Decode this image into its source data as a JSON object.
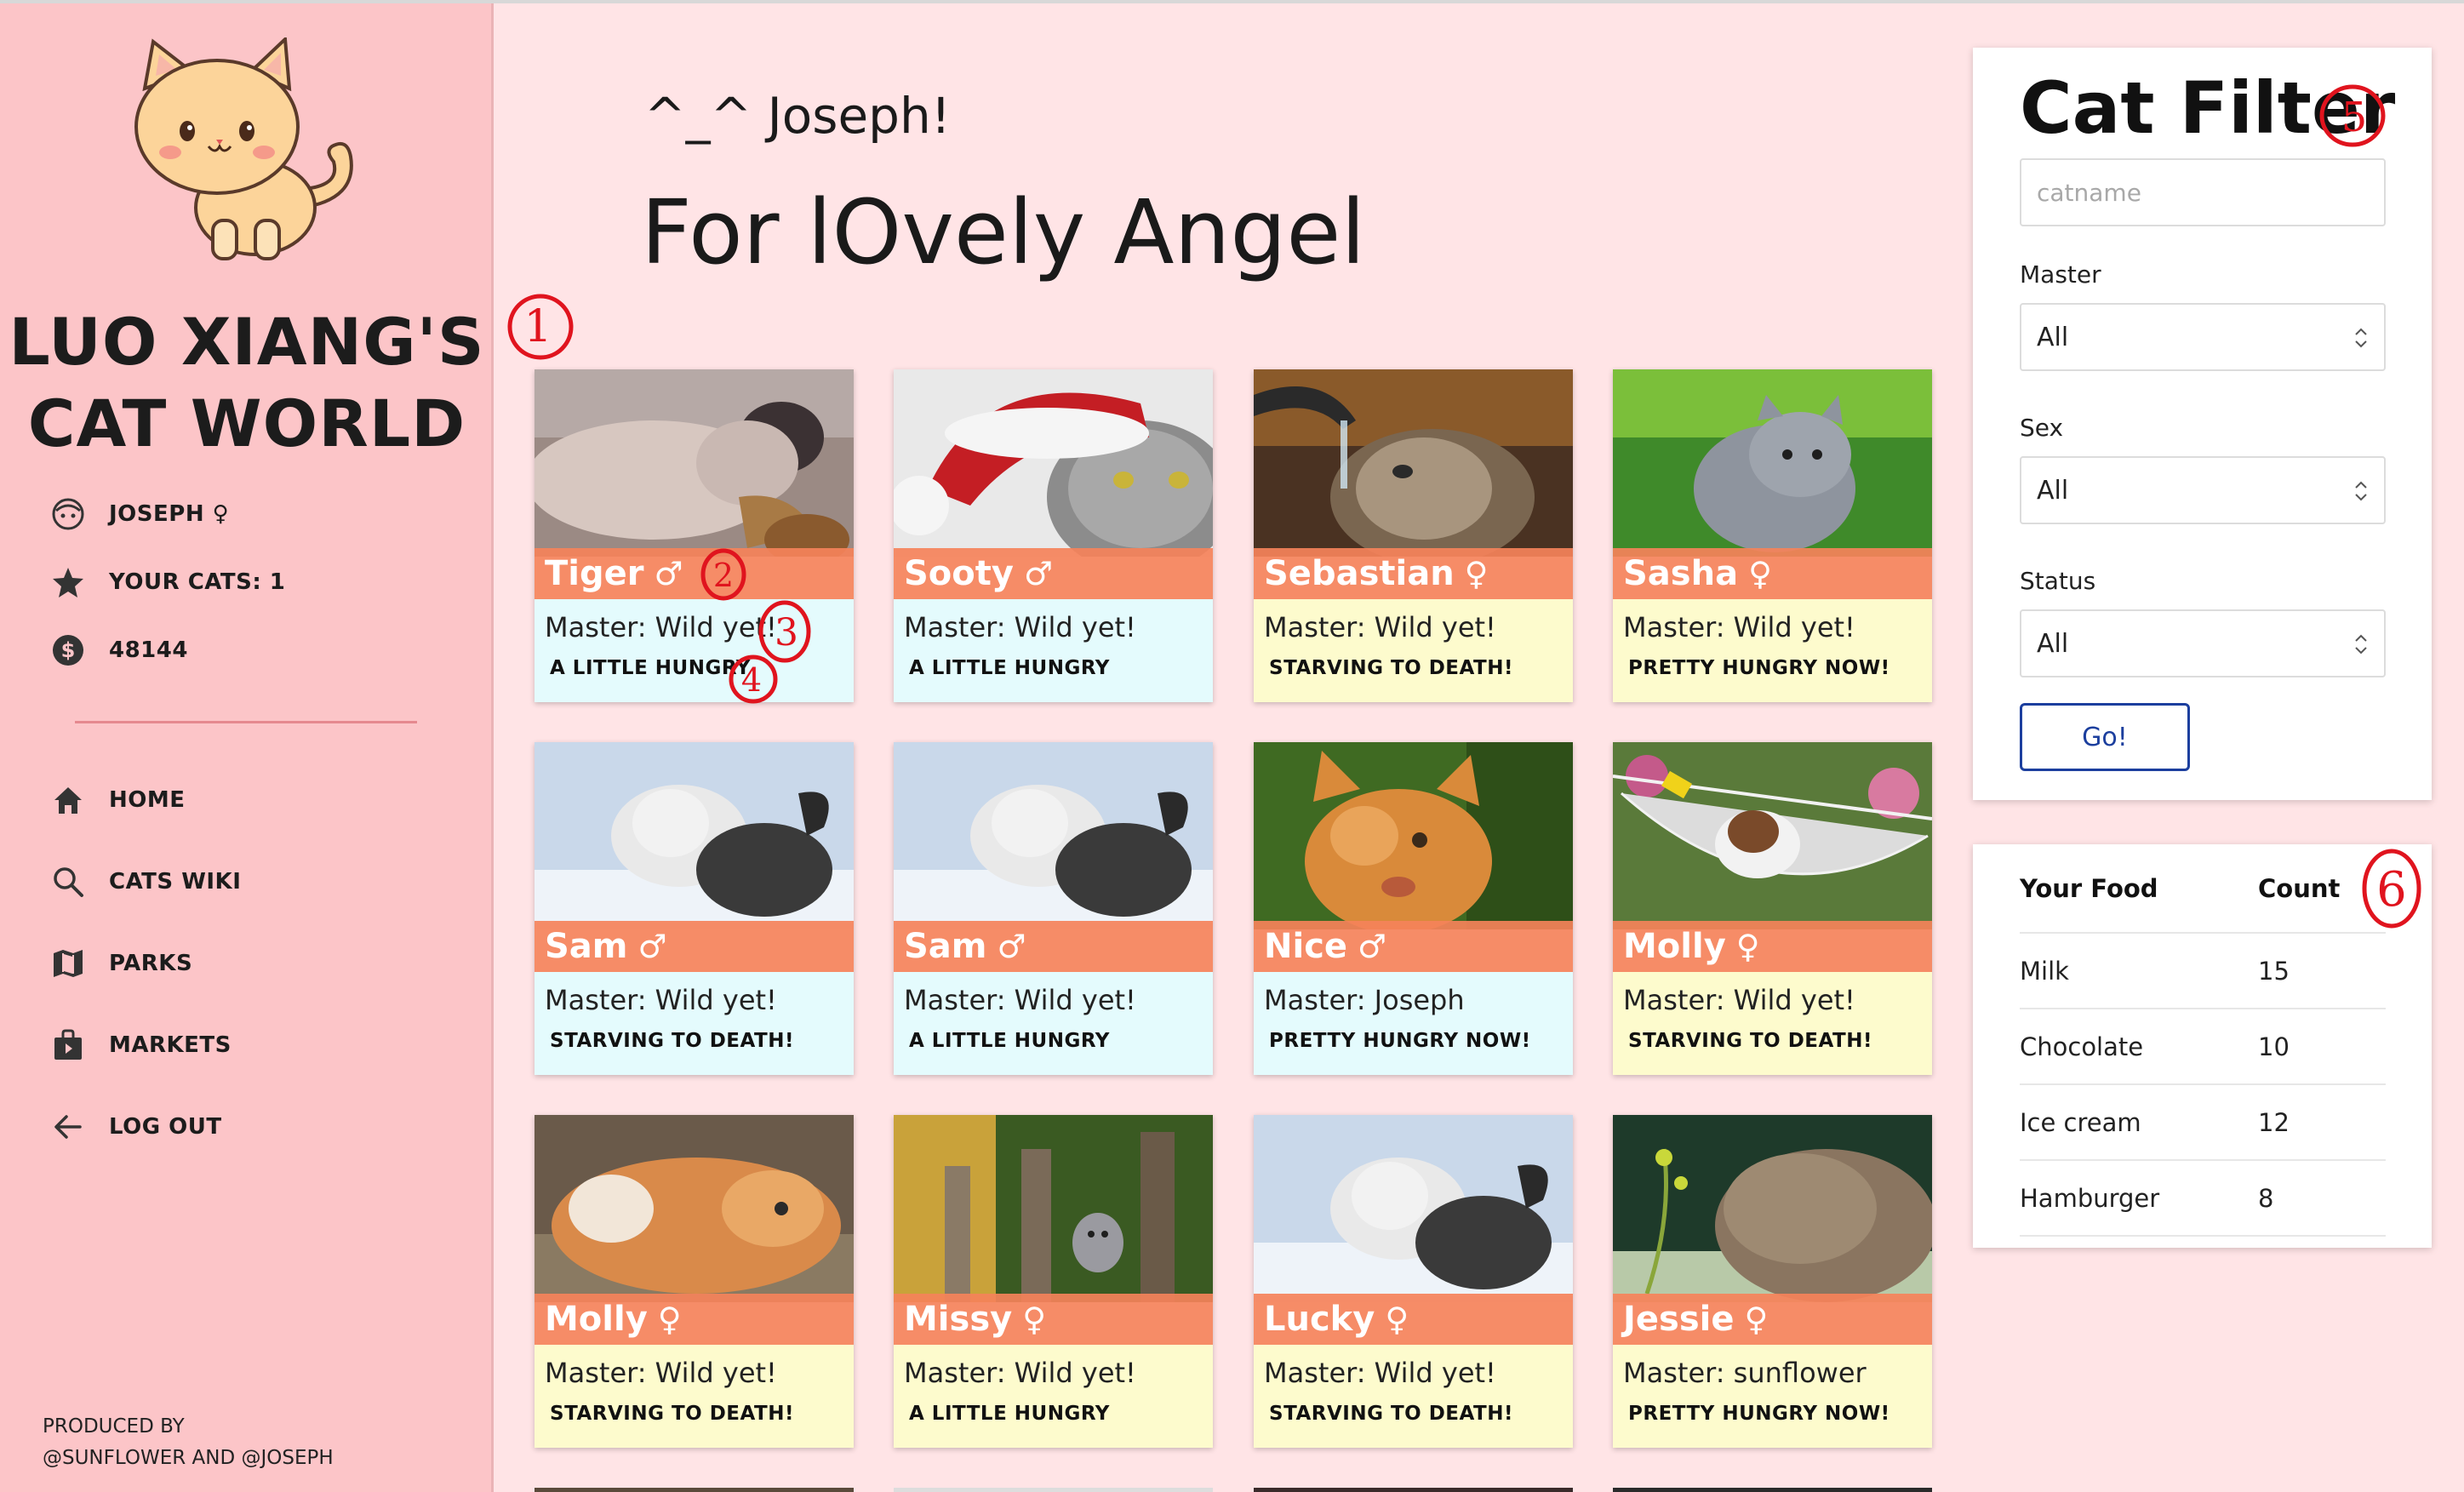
{
  "sidebar": {
    "brand_line1": "LUO XIANG'S",
    "brand_line2": "CAT WORLD",
    "user": {
      "name": "JOSEPH ♀",
      "cats": "YOUR CATS: 1",
      "money": "48144"
    },
    "nav": [
      {
        "label": "HOME",
        "icon": "home-icon"
      },
      {
        "label": "CATS WIKI",
        "icon": "search-icon"
      },
      {
        "label": "PARKS",
        "icon": "map-icon"
      },
      {
        "label": "MARKETS",
        "icon": "shopping-bag-icon"
      },
      {
        "label": "LOG OUT",
        "icon": "arrow-left-icon"
      }
    ],
    "credits_line1": "PRODUCED BY",
    "credits_line2": "@SUNFLOWER AND @JOSEPH"
  },
  "main": {
    "greeting": "^_^ Joseph!",
    "title": "For lOvely Angel",
    "cards": [
      {
        "name": "Tiger",
        "sex": "♂",
        "master": "Master: Wild yet!",
        "status": "A LITTLE HUNGRY",
        "tint": "mint",
        "photo": "sleeping-kitten-photo"
      },
      {
        "name": "Sooty",
        "sex": "♂",
        "master": "Master: Wild yet!",
        "status": "A LITTLE HUNGRY",
        "tint": "mint",
        "photo": "santa-hat-cat-photo"
      },
      {
        "name": "Sebastian",
        "sex": "♀",
        "master": "Master: Wild yet!",
        "status": "STARVING TO DEATH!",
        "tint": "cream",
        "photo": "cat-drinking-tap-photo"
      },
      {
        "name": "Sasha",
        "sex": "♀",
        "master": "Master: Wild yet!",
        "status": "PRETTY HUNGRY NOW!",
        "tint": "cream",
        "photo": "grey-kitten-grass-photo"
      },
      {
        "name": "Sam",
        "sex": "♂",
        "master": "Master: Wild yet!",
        "status": "STARVING TO DEATH!",
        "tint": "mint",
        "photo": "cat-in-snow-photo"
      },
      {
        "name": "Sam",
        "sex": "♂",
        "master": "Master: Wild yet!",
        "status": "A LITTLE HUNGRY",
        "tint": "mint",
        "photo": "cat-in-snow-photo"
      },
      {
        "name": "Nice",
        "sex": "♂",
        "master": "Master: Joseph",
        "status": "PRETTY HUNGRY NOW!",
        "tint": "mint",
        "photo": "ginger-kitten-paw-photo"
      },
      {
        "name": "Molly",
        "sex": "♀",
        "master": "Master: Wild yet!",
        "status": "STARVING TO DEATH!",
        "tint": "cream",
        "photo": "kitten-hammock-photo"
      },
      {
        "name": "Molly",
        "sex": "♀",
        "master": "Master: Wild yet!",
        "status": "STARVING TO DEATH!",
        "tint": "cream",
        "photo": "orange-cat-lying-photo"
      },
      {
        "name": "Missy",
        "sex": "♀",
        "master": "Master: Wild yet!",
        "status": "A LITTLE HUNGRY",
        "tint": "cream",
        "photo": "kitten-fence-photo"
      },
      {
        "name": "Lucky",
        "sex": "♀",
        "master": "Master: Wild yet!",
        "status": "STARVING TO DEATH!",
        "tint": "cream",
        "photo": "cat-in-snow-photo"
      },
      {
        "name": "Jessie",
        "sex": "♀",
        "master": "Master: sunflower",
        "status": "PRETTY HUNGRY NOW!",
        "tint": "cream",
        "photo": "tabby-cat-sniffing-photo"
      }
    ]
  },
  "filter": {
    "title": "Cat Filter",
    "name_placeholder": "catname",
    "master_label": "Master",
    "master_value": "All",
    "sex_label": "Sex",
    "sex_value": "All",
    "status_label": "Status",
    "status_value": "All",
    "go_label": "Go!"
  },
  "food": {
    "header_food": "Your Food",
    "header_count": "Count",
    "rows": [
      {
        "food": "Milk",
        "count": "15"
      },
      {
        "food": "Chocolate",
        "count": "10"
      },
      {
        "food": "Ice cream",
        "count": "12"
      },
      {
        "food": "Hamburger",
        "count": "8"
      }
    ]
  },
  "annotations": [
    "1",
    "2",
    "3",
    "4",
    "5",
    "6"
  ],
  "colors": {
    "page_bg": "#ffe4e6",
    "sidebar_bg": "#fcc5c8",
    "banner": "#f5825a",
    "card_mint": "#e4fbfd",
    "card_cream": "#fdfbcd",
    "go_button": "#1c3f9e",
    "annotation_red": "#e0141e"
  }
}
